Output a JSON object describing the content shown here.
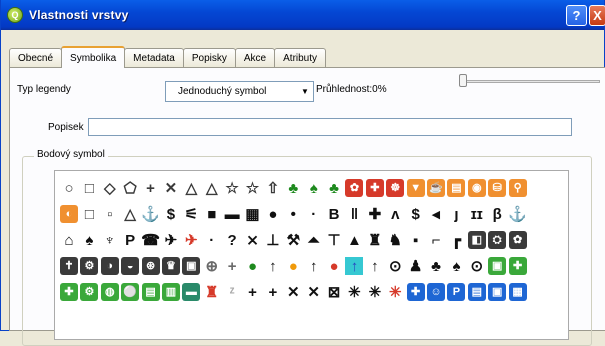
{
  "window": {
    "title": "Vlastnosti vrstvy",
    "help": "?",
    "close": "X",
    "app_icon_text": "Q"
  },
  "tabs": [
    "Obecné",
    "Symbolika",
    "Metadata",
    "Popisky",
    "Akce",
    "Atributy"
  ],
  "active_tab": "Symbolika",
  "form": {
    "legend_type_label": "Typ legendy",
    "legend_type_value": "Jednoduchý symbol",
    "transparency_label": "Průhlednost:0%",
    "transparency_value": 0,
    "caption_label": "Popisek",
    "caption_value": "",
    "point_symbol_label": "Bodový symbol"
  },
  "symbols": [
    [
      {
        "g": "○",
        "c": "#3a3a3a",
        "icon": "circle-outline"
      },
      {
        "g": "□",
        "c": "#3a3a3a",
        "icon": "square-outline"
      },
      {
        "g": "◇",
        "c": "#3a3a3a",
        "icon": "diamond-outline"
      },
      {
        "g": "⬠",
        "c": "#3a3a3a",
        "icon": "pentagon-outline"
      },
      {
        "g": "+",
        "c": "#3a3a3a",
        "icon": "cross"
      },
      {
        "g": "✕",
        "c": "#3a3a3a",
        "icon": "x-cross"
      },
      {
        "g": "△",
        "c": "#3a3a3a",
        "icon": "triangle-outline"
      },
      {
        "g": "△",
        "c": "#3a3a3a",
        "icon": "triangle-outline-2"
      },
      {
        "g": "☆",
        "c": "#3a3a3a",
        "icon": "star-outline"
      },
      {
        "g": "☆",
        "c": "#3a3a3a",
        "icon": "star-outline-2"
      },
      {
        "g": "⇧",
        "c": "#3a3a3a",
        "icon": "arrow-up"
      },
      {
        "g": "♣",
        "c": "#1e8a1e",
        "icon": "tree-green"
      },
      {
        "g": "♠",
        "c": "#1e8a1e",
        "icon": "tree-green-2"
      },
      {
        "g": "♣",
        "c": "#1e8a1e",
        "icon": "shrub-green"
      },
      {
        "g": "✿",
        "c": "#d63a2a",
        "sq": "#d63a2a",
        "icon": "flower-red"
      },
      {
        "g": "✚",
        "c": "#d63a2a",
        "sq": "#d63a2a",
        "icon": "hospital-red"
      },
      {
        "g": "☸",
        "c": "#d63a2a",
        "sq": "#d63a2a",
        "icon": "symbol-red"
      },
      {
        "g": "▼",
        "c": "#f09030",
        "sq": "#f09030",
        "icon": "orange-a"
      },
      {
        "g": "☕",
        "c": "#f09030",
        "sq": "#f09030",
        "icon": "orange-b"
      },
      {
        "g": "▤",
        "c": "#f09030",
        "sq": "#f09030",
        "icon": "orange-c"
      },
      {
        "g": "◉",
        "c": "#f09030",
        "sq": "#f09030",
        "icon": "orange-d"
      },
      {
        "g": "⛁",
        "c": "#f09030",
        "sq": "#f09030",
        "icon": "orange-e"
      },
      {
        "g": "⚲",
        "c": "#f09030",
        "sq": "#f09030",
        "icon": "orange-f"
      }
    ],
    [
      {
        "g": "◐",
        "c": "#f09030",
        "sq": "#f09030",
        "icon": "orange-g"
      },
      {
        "g": "□",
        "c": "#3a3a3a",
        "icon": "square-small"
      },
      {
        "g": "▫",
        "c": "#3a3a3a",
        "icon": "square-tiny"
      },
      {
        "g": "△",
        "c": "#3a3a3a",
        "icon": "triangle-small"
      },
      {
        "g": "⚓",
        "c": "#111",
        "icon": "anchor"
      },
      {
        "g": "$",
        "c": "#111",
        "icon": "dollar"
      },
      {
        "g": "⚟",
        "c": "#111",
        "icon": "atm"
      },
      {
        "g": "■",
        "c": "#111",
        "icon": "camera"
      },
      {
        "g": "▬",
        "c": "#111",
        "icon": "car"
      },
      {
        "g": "▦",
        "c": "#111",
        "icon": "building"
      },
      {
        "g": "●",
        "c": "#111",
        "icon": "dot-large"
      },
      {
        "g": "•",
        "c": "#111",
        "icon": "dot-small"
      },
      {
        "g": "·",
        "c": "#111",
        "icon": "dot-tiny"
      },
      {
        "g": "B",
        "c": "#111",
        "icon": "bar"
      },
      {
        "g": "‖",
        "c": "#111",
        "icon": "toilets"
      },
      {
        "g": "✚",
        "c": "#111",
        "icon": "first-aid"
      },
      {
        "g": "ᴧ",
        "c": "#111",
        "icon": "skier"
      },
      {
        "g": "$",
        "c": "#111",
        "icon": "exchange"
      },
      {
        "g": "◂",
        "c": "#111",
        "icon": "fish"
      },
      {
        "g": "ȷ",
        "c": "#111",
        "icon": "golf"
      },
      {
        "g": "ɪɪ",
        "c": "#111",
        "icon": "restaurant"
      },
      {
        "g": "β",
        "c": "#111",
        "icon": "shop"
      },
      {
        "g": "⚓",
        "c": "#111",
        "icon": "port"
      }
    ],
    [
      {
        "g": "⌂",
        "c": "#111",
        "icon": "house"
      },
      {
        "g": "♠",
        "c": "#111",
        "icon": "tree-black"
      },
      {
        "g": "♆",
        "c": "#111",
        "icon": "pump"
      },
      {
        "g": "P",
        "c": "#111",
        "icon": "parking"
      },
      {
        "g": "☎",
        "c": "#111",
        "icon": "telephone"
      },
      {
        "g": "✈",
        "c": "#111",
        "icon": "airport"
      },
      {
        "g": "✈",
        "c": "#d63a2a",
        "icon": "airport-red"
      },
      {
        "g": "·",
        "c": "#111",
        "icon": "dot-mini"
      },
      {
        "g": "?",
        "c": "#111",
        "icon": "information"
      },
      {
        "g": "⨯",
        "c": "#111",
        "icon": "hunter"
      },
      {
        "g": "⊥",
        "c": "#111",
        "icon": "mine"
      },
      {
        "g": "⚒",
        "c": "#111",
        "icon": "tools"
      },
      {
        "g": "⏶",
        "c": "#111",
        "icon": "boat"
      },
      {
        "g": "⊤",
        "c": "#111",
        "icon": "chairlift"
      },
      {
        "g": "▲",
        "c": "#111",
        "icon": "peak"
      },
      {
        "g": "♜",
        "c": "#111",
        "icon": "tower"
      },
      {
        "g": "♞",
        "c": "#111",
        "icon": "person"
      },
      {
        "g": "▪",
        "c": "#111",
        "icon": "point-square"
      },
      {
        "g": "⌐",
        "c": "#111",
        "icon": "marker"
      },
      {
        "g": "┏",
        "c": "#111",
        "icon": "angle"
      },
      {
        "g": "◧",
        "c": "#3a3a3a",
        "sq": "#3a3a3a",
        "icon": "dark-a"
      },
      {
        "g": "⛭",
        "c": "#3a3a3a",
        "sq": "#3a3a3a",
        "icon": "dark-b"
      },
      {
        "g": "✿",
        "c": "#3a3a3a",
        "sq": "#3a3a3a",
        "icon": "dark-c"
      }
    ],
    [
      {
        "g": "✝",
        "c": "#3a3a3a",
        "sq": "#3a3a3a",
        "icon": "church"
      },
      {
        "g": "⚙",
        "c": "#3a3a3a",
        "sq": "#3a3a3a",
        "icon": "gear-dark"
      },
      {
        "g": "◑",
        "c": "#3a3a3a",
        "sq": "#3a3a3a",
        "icon": "dark-d"
      },
      {
        "g": "◒",
        "c": "#3a3a3a",
        "sq": "#3a3a3a",
        "icon": "dark-e"
      },
      {
        "g": "⊛",
        "c": "#3a3a3a",
        "sq": "#3a3a3a",
        "icon": "dark-f"
      },
      {
        "g": "♛",
        "c": "#3a3a3a",
        "sq": "#3a3a3a",
        "icon": "dark-g"
      },
      {
        "g": "▣",
        "c": "#3a3a3a",
        "sq": "#3a3a3a",
        "icon": "dark-h"
      },
      {
        "g": "⊕",
        "c": "#6a6a6a",
        "icon": "crosshair"
      },
      {
        "g": "+",
        "c": "#6a6a6a",
        "icon": "plus-thin"
      },
      {
        "g": "●",
        "c": "#1e8a1e",
        "icon": "green-dot"
      },
      {
        "g": "↑",
        "c": "#111",
        "icon": "arrow-black"
      },
      {
        "g": "●",
        "c": "#f09a0a",
        "icon": "orange-dot"
      },
      {
        "g": "↑",
        "c": "#111",
        "icon": "arrow-black-2"
      },
      {
        "g": "●",
        "c": "#d63a2a",
        "icon": "red-dot"
      },
      {
        "g": "↑",
        "c": "#2848c0",
        "sel": true,
        "icon": "arrow-blue-selected"
      },
      {
        "g": "↑",
        "c": "#111",
        "icon": "arrow-black-3"
      },
      {
        "g": "⊙",
        "c": "#111",
        "icon": "circle-a"
      },
      {
        "g": "♟",
        "c": "#111",
        "icon": "pawn"
      },
      {
        "g": "♣",
        "c": "#111",
        "icon": "club"
      },
      {
        "g": "♠",
        "c": "#111",
        "icon": "spade"
      },
      {
        "g": "⊙",
        "c": "#111",
        "icon": "circle-b"
      },
      {
        "g": "▣",
        "c": "#3aa83a",
        "sq": "#3aa83a",
        "icon": "green-a"
      },
      {
        "g": "✚",
        "c": "#3aa83a",
        "sq": "#3aa83a",
        "icon": "green-b"
      }
    ],
    [
      {
        "g": "✚",
        "c": "#3aa83a",
        "sq": "#3aa83a",
        "icon": "green-c"
      },
      {
        "g": "⚙",
        "c": "#3aa83a",
        "sq": "#3aa83a",
        "icon": "green-d"
      },
      {
        "g": "◍",
        "c": "#3aa83a",
        "sq": "#3aa83a",
        "icon": "green-e"
      },
      {
        "g": "⚪",
        "c": "#3aa83a",
        "sq": "#3aa83a",
        "icon": "green-f"
      },
      {
        "g": "▤",
        "c": "#3aa83a",
        "sq": "#3aa83a",
        "icon": "green-g"
      },
      {
        "g": "▥",
        "c": "#3aa83a",
        "sq": "#3aa83a",
        "icon": "green-h"
      },
      {
        "g": "▬",
        "c": "#2a8a6a",
        "sq": "#2a8a6a",
        "icon": "teal-a"
      },
      {
        "g": "♜",
        "c": "#d63a2a",
        "icon": "red-tower"
      },
      {
        "g": "ᶻ",
        "c": "#aaa",
        "icon": "small-mark"
      },
      {
        "g": "+",
        "c": "#111",
        "icon": "plus-a"
      },
      {
        "g": "+",
        "c": "#111",
        "icon": "plus-b"
      },
      {
        "g": "✕",
        "c": "#111",
        "icon": "x-a"
      },
      {
        "g": "✕",
        "c": "#111",
        "icon": "x-b"
      },
      {
        "g": "⊠",
        "c": "#111",
        "icon": "x-box"
      },
      {
        "g": "✳",
        "c": "#111",
        "icon": "asterisk-a"
      },
      {
        "g": "✳",
        "c": "#111",
        "icon": "asterisk-b"
      },
      {
        "g": "✳",
        "c": "#d63a2a",
        "icon": "asterisk-red"
      },
      {
        "g": "✚",
        "c": "#1e66d4",
        "sq": "#1e66d4",
        "icon": "blue-a"
      },
      {
        "g": "☺",
        "c": "#1e66d4",
        "sq": "#1e66d4",
        "icon": "blue-b"
      },
      {
        "g": "P",
        "c": "#1e66d4",
        "sq": "#1e66d4",
        "icon": "blue-parking"
      },
      {
        "g": "▤",
        "c": "#1e66d4",
        "sq": "#1e66d4",
        "icon": "blue-c"
      },
      {
        "g": "▣",
        "c": "#1e66d4",
        "sq": "#1e66d4",
        "icon": "blue-d"
      },
      {
        "g": "▦",
        "c": "#1e66d4",
        "sq": "#1e66d4",
        "icon": "blue-e"
      }
    ]
  ]
}
